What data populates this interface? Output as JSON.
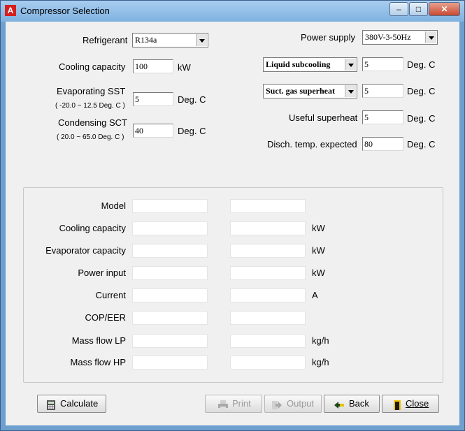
{
  "window": {
    "title": "Compressor Selection",
    "app_icon": "A",
    "controls": {
      "minimize": "–",
      "maximize": "□",
      "close": "✕"
    }
  },
  "inputs": {
    "refrigerant": {
      "label": "Refrigerant",
      "value": "R134a"
    },
    "cooling_capacity": {
      "label": "Cooling capacity",
      "value": "100",
      "unit": "kW"
    },
    "evaporating": {
      "label": "Evaporating SST",
      "range": "( -20.0 ~ 12.5 Deg. C )",
      "value": "5",
      "unit": "Deg. C"
    },
    "condensing": {
      "label": "Condensing SCT",
      "range": "( 20.0 ~ 65.0 Deg. C )",
      "value": "40",
      "unit": "Deg. C"
    },
    "power_supply": {
      "label": "Power supply",
      "value": "380V-3-50Hz"
    },
    "liquid_subcooling": {
      "option": "Liquid subcooling",
      "value": "5",
      "unit": "Deg. C"
    },
    "suction_superheat": {
      "option": "Suct. gas superheat",
      "value": "5",
      "unit": "Deg. C"
    },
    "useful_superheat": {
      "label": "Useful superheat",
      "value": "5",
      "unit": "Deg. C"
    },
    "discharge_temp": {
      "label": "Disch. temp. expected",
      "value": "80",
      "unit": "Deg. C"
    }
  },
  "results": [
    {
      "label": "Model",
      "unit": ""
    },
    {
      "label": "Cooling capacity",
      "unit": "kW"
    },
    {
      "label": "Evaporator capacity",
      "unit": "kW"
    },
    {
      "label": "Power input",
      "unit": "kW"
    },
    {
      "label": "Current",
      "unit": "A"
    },
    {
      "label": "COP/EER",
      "unit": ""
    },
    {
      "label": "Mass flow LP",
      "unit": "kg/h"
    },
    {
      "label": "Mass flow HP",
      "unit": "kg/h"
    }
  ],
  "buttons": {
    "calculate": "Calculate",
    "print": "Print",
    "output": "Output",
    "back": "Back",
    "close": "Close"
  },
  "icons": {
    "calculate": "calculator-icon",
    "print": "printer-icon",
    "output": "output-arrow-icon",
    "back": "back-arrow-icon",
    "close": "door-exit-icon"
  },
  "colors": {
    "title_bar": "#7fb2e0",
    "close_button": "#c84a33",
    "window_background": "#f0f0f0"
  }
}
